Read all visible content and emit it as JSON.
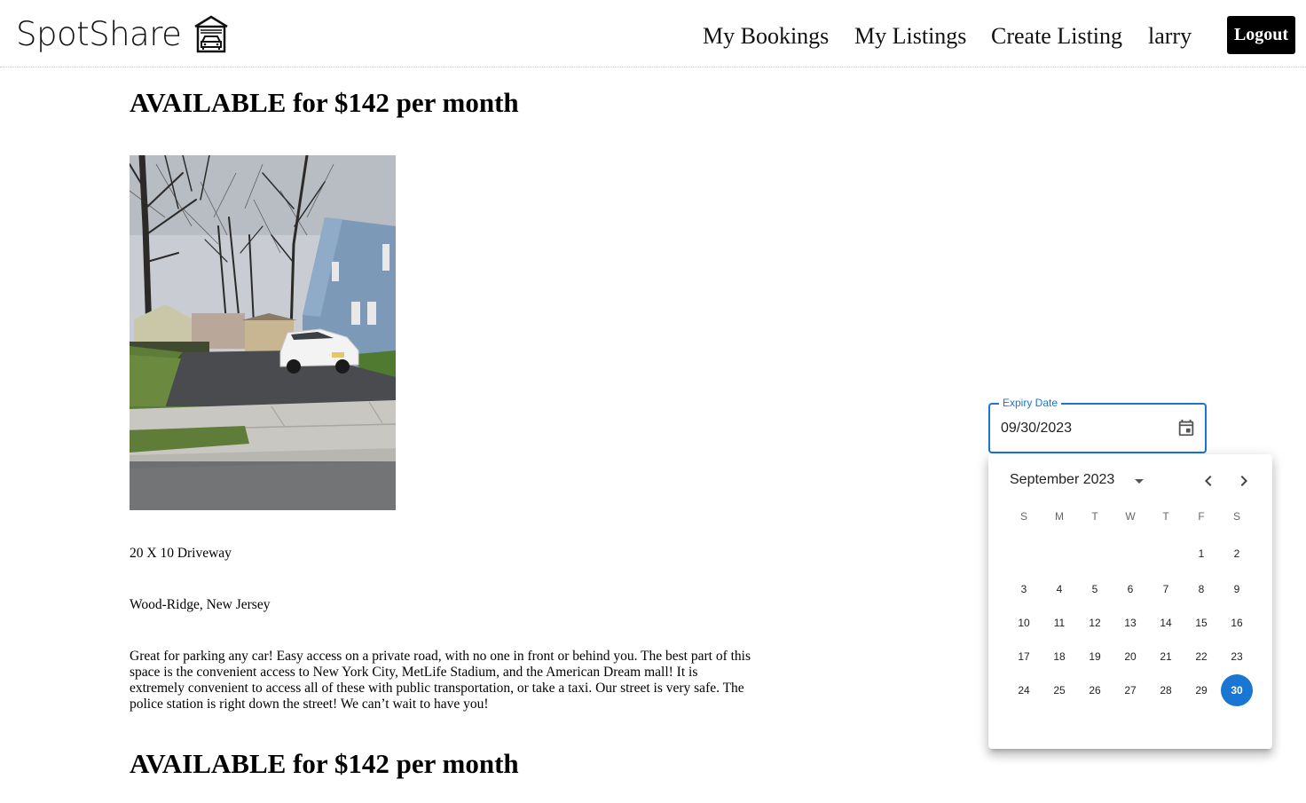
{
  "header": {
    "brand": "SpotShare",
    "brand_icon": "garage-car-icon",
    "nav": {
      "my_bookings": "My Bookings",
      "my_listings": "My Listings",
      "create_listing": "Create Listing",
      "user": "larry",
      "logout": "Logout"
    }
  },
  "listing": {
    "heading": "AVAILABLE for $142 per month",
    "photo": "driveway-photo",
    "size": "20 X 10 Driveway",
    "location": "Wood-Ridge, New Jersey",
    "description": "Great for parking any car! Easy access on a private road, with no one in front or behind you. The best part of this space is the convenient access to New York City, MetLife Stadium, and the American Dream mall! It is extremely convenient to access all of these with public transportation, or take a taxi. Our street is very safe. The police station is right down the street! We can’t wait to have you!"
  },
  "next_listing": {
    "heading": "AVAILABLE for $142 per month"
  },
  "expiry_date": {
    "label": "Expiry Date",
    "value": "09/30/2023",
    "icon": "calendar-icon"
  },
  "datepicker": {
    "month_label": "September 2023",
    "weekdays": [
      "S",
      "M",
      "T",
      "W",
      "T",
      "F",
      "S"
    ],
    "first_weekday_index": 5,
    "days_in_month": 30,
    "selected_day": 30,
    "accent": "#1976d2"
  }
}
